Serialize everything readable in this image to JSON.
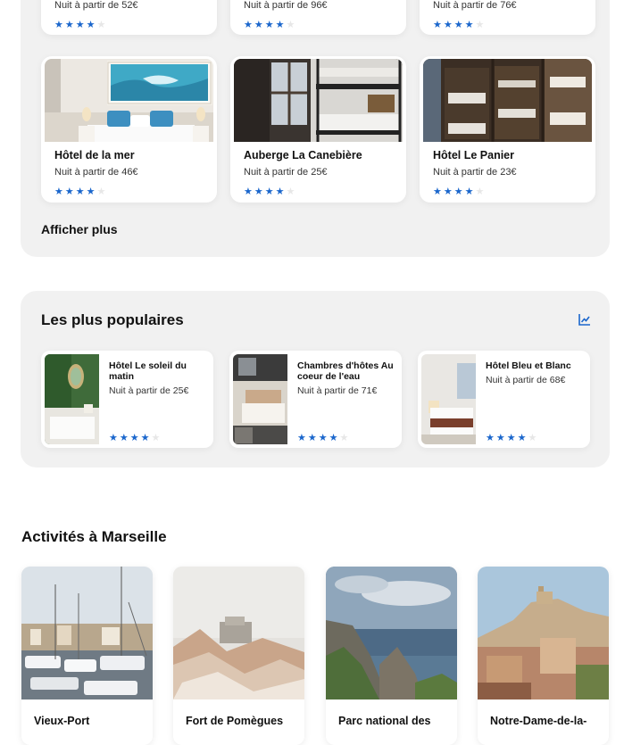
{
  "top_row": [
    {
      "price": "Nuit à partir de 52€",
      "rating": 4
    },
    {
      "price": "Nuit à partir de 96€",
      "rating": 4
    },
    {
      "price": "Nuit à partir de 76€",
      "rating": 4
    }
  ],
  "hotels": [
    {
      "name": "Hôtel de la mer",
      "price": "Nuit à partir de 46€",
      "rating": 4
    },
    {
      "name": "Auberge La Canebière",
      "price": "Nuit à partir de 25€",
      "rating": 4
    },
    {
      "name": "Hôtel Le Panier",
      "price": "Nuit à partir de 23€",
      "rating": 4
    }
  ],
  "show_more_label": "Afficher plus",
  "popular": {
    "title": "Les plus populaires",
    "icon": "trending-icon",
    "items": [
      {
        "name": "Hôtel Le soleil du matin",
        "price": "Nuit à partir de 25€",
        "rating": 4
      },
      {
        "name": "Chambres d'hôtes Au coeur de l'eau",
        "price": "Nuit à partir de 71€",
        "rating": 4
      },
      {
        "name": "Hôtel Bleu et Blanc",
        "price": "Nuit à partir de 68€",
        "rating": 4
      }
    ]
  },
  "activities": {
    "title": "Activités à Marseille",
    "items": [
      {
        "name": "Vieux-Port"
      },
      {
        "name": "Fort de Pomègues"
      },
      {
        "name": "Parc national des"
      },
      {
        "name": "Notre-Dame-de-la-"
      }
    ]
  },
  "colors": {
    "accent": "#1a66cc",
    "panel": "#f1f1f1"
  }
}
